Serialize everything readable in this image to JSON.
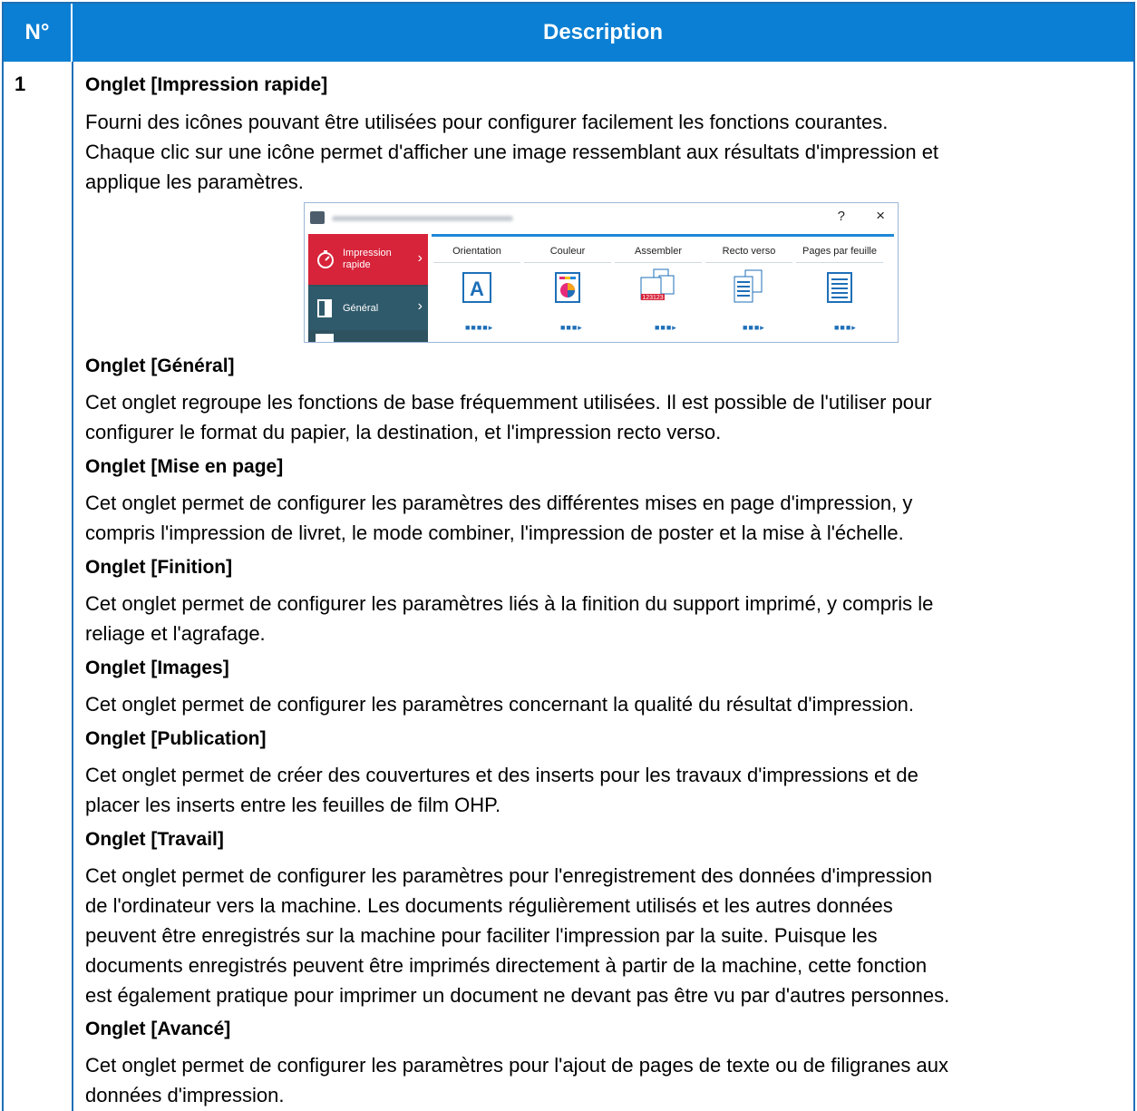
{
  "header": {
    "num": "N°",
    "desc": "Description"
  },
  "row": {
    "num": "1"
  },
  "sections": [
    {
      "title": "Onglet [Impression rapide]",
      "lines": [
        "Fourni des icônes pouvant être utilisées pour configurer facilement les fonctions courantes.",
        "Chaque clic sur une icône permet d'afficher une image ressemblant aux résultats d'impression et",
        "applique les paramètres."
      ]
    },
    {
      "title": "Onglet [Général]",
      "lines": [
        "Cet onglet regroupe les fonctions de base fréquemment utilisées. Il est possible de l'utiliser pour",
        "configurer le format du papier, la destination, et l'impression recto verso."
      ]
    },
    {
      "title": "Onglet [Mise en page]",
      "lines": [
        "Cet onglet permet de configurer les paramètres des différentes mises en page d'impression, y",
        "compris l'impression de livret, le mode combiner, l'impression de poster et la mise à l'échelle."
      ]
    },
    {
      "title": "Onglet [Finition]",
      "lines": [
        "Cet onglet permet de configurer les paramètres liés à la finition du support imprimé, y compris le",
        "reliage et l'agrafage."
      ]
    },
    {
      "title": "Onglet [Images]",
      "lines": [
        "Cet onglet permet de configurer les paramètres concernant la qualité du résultat d'impression."
      ]
    },
    {
      "title": "Onglet [Publication]",
      "lines": [
        "Cet onglet permet de créer des couvertures et des inserts pour les travaux d'impressions et de",
        "placer les inserts entre les feuilles de film OHP."
      ]
    },
    {
      "title": "Onglet [Travail]",
      "lines": [
        "Cet onglet permet de configurer les paramètres pour l'enregistrement des données d'impression",
        "de l'ordinateur vers la machine. Les documents régulièrement utilisés et les autres données",
        "peuvent être enregistrés sur la machine pour faciliter l'impression par la suite. Puisque les",
        "documents enregistrés peuvent être imprimés directement à partir de la machine, cette fonction",
        "est également pratique pour imprimer un document ne devant pas être vu par d'autres personnes."
      ]
    },
    {
      "title": "Onglet [Avancé]",
      "lines": [
        "Cet onglet permet de configurer les paramètres pour l'ajout de pages de texte ou de filigranes aux",
        "données d'impression."
      ]
    }
  ],
  "figure": {
    "help": "?",
    "close": "×",
    "sidebar": [
      {
        "label": "Impression rapide",
        "icon": "stopwatch-icon"
      },
      {
        "label": "Général",
        "icon": "page-icon"
      }
    ],
    "columns": [
      {
        "label": "Orientation",
        "icon": "letter-a-icon"
      },
      {
        "label": "Couleur",
        "icon": "color-page-icon"
      },
      {
        "label": "Assembler",
        "icon": "collate-icon"
      },
      {
        "label": "Recto verso",
        "icon": "duplex-icon"
      },
      {
        "label": "Pages par feuille",
        "icon": "pages-per-sheet-icon"
      }
    ]
  }
}
